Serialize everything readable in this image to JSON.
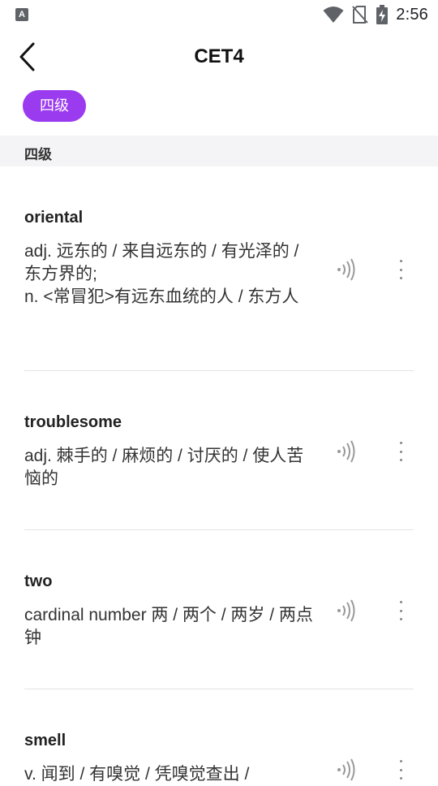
{
  "status_bar": {
    "left_icon": "A",
    "time": "2:56",
    "icons": [
      "wifi-icon",
      "no-sim-icon",
      "battery-charging-icon"
    ]
  },
  "header": {
    "title": "CET4",
    "back_icon": "chevron-left-icon"
  },
  "filter": {
    "chip_label": "四级",
    "chip_color": "#9b3bf0"
  },
  "section": {
    "label": "四级"
  },
  "words": [
    {
      "word": "oriental",
      "definition": "adj. 远东的 / 来自远东的 / 有光泽的 / 东方界的;\nn. <常冒犯>有远东血统的人 / 东方人"
    },
    {
      "word": "troublesome",
      "definition": "adj. 棘手的 / 麻烦的 / 讨厌的 / 使人苦恼的"
    },
    {
      "word": "two",
      "definition": "cardinal number 两 / 两个 / 两岁 / 两点钟"
    },
    {
      "word": "smell",
      "definition": "v. 闻到 / 有嗅觉 / 凭嗅觉查出 /"
    }
  ]
}
